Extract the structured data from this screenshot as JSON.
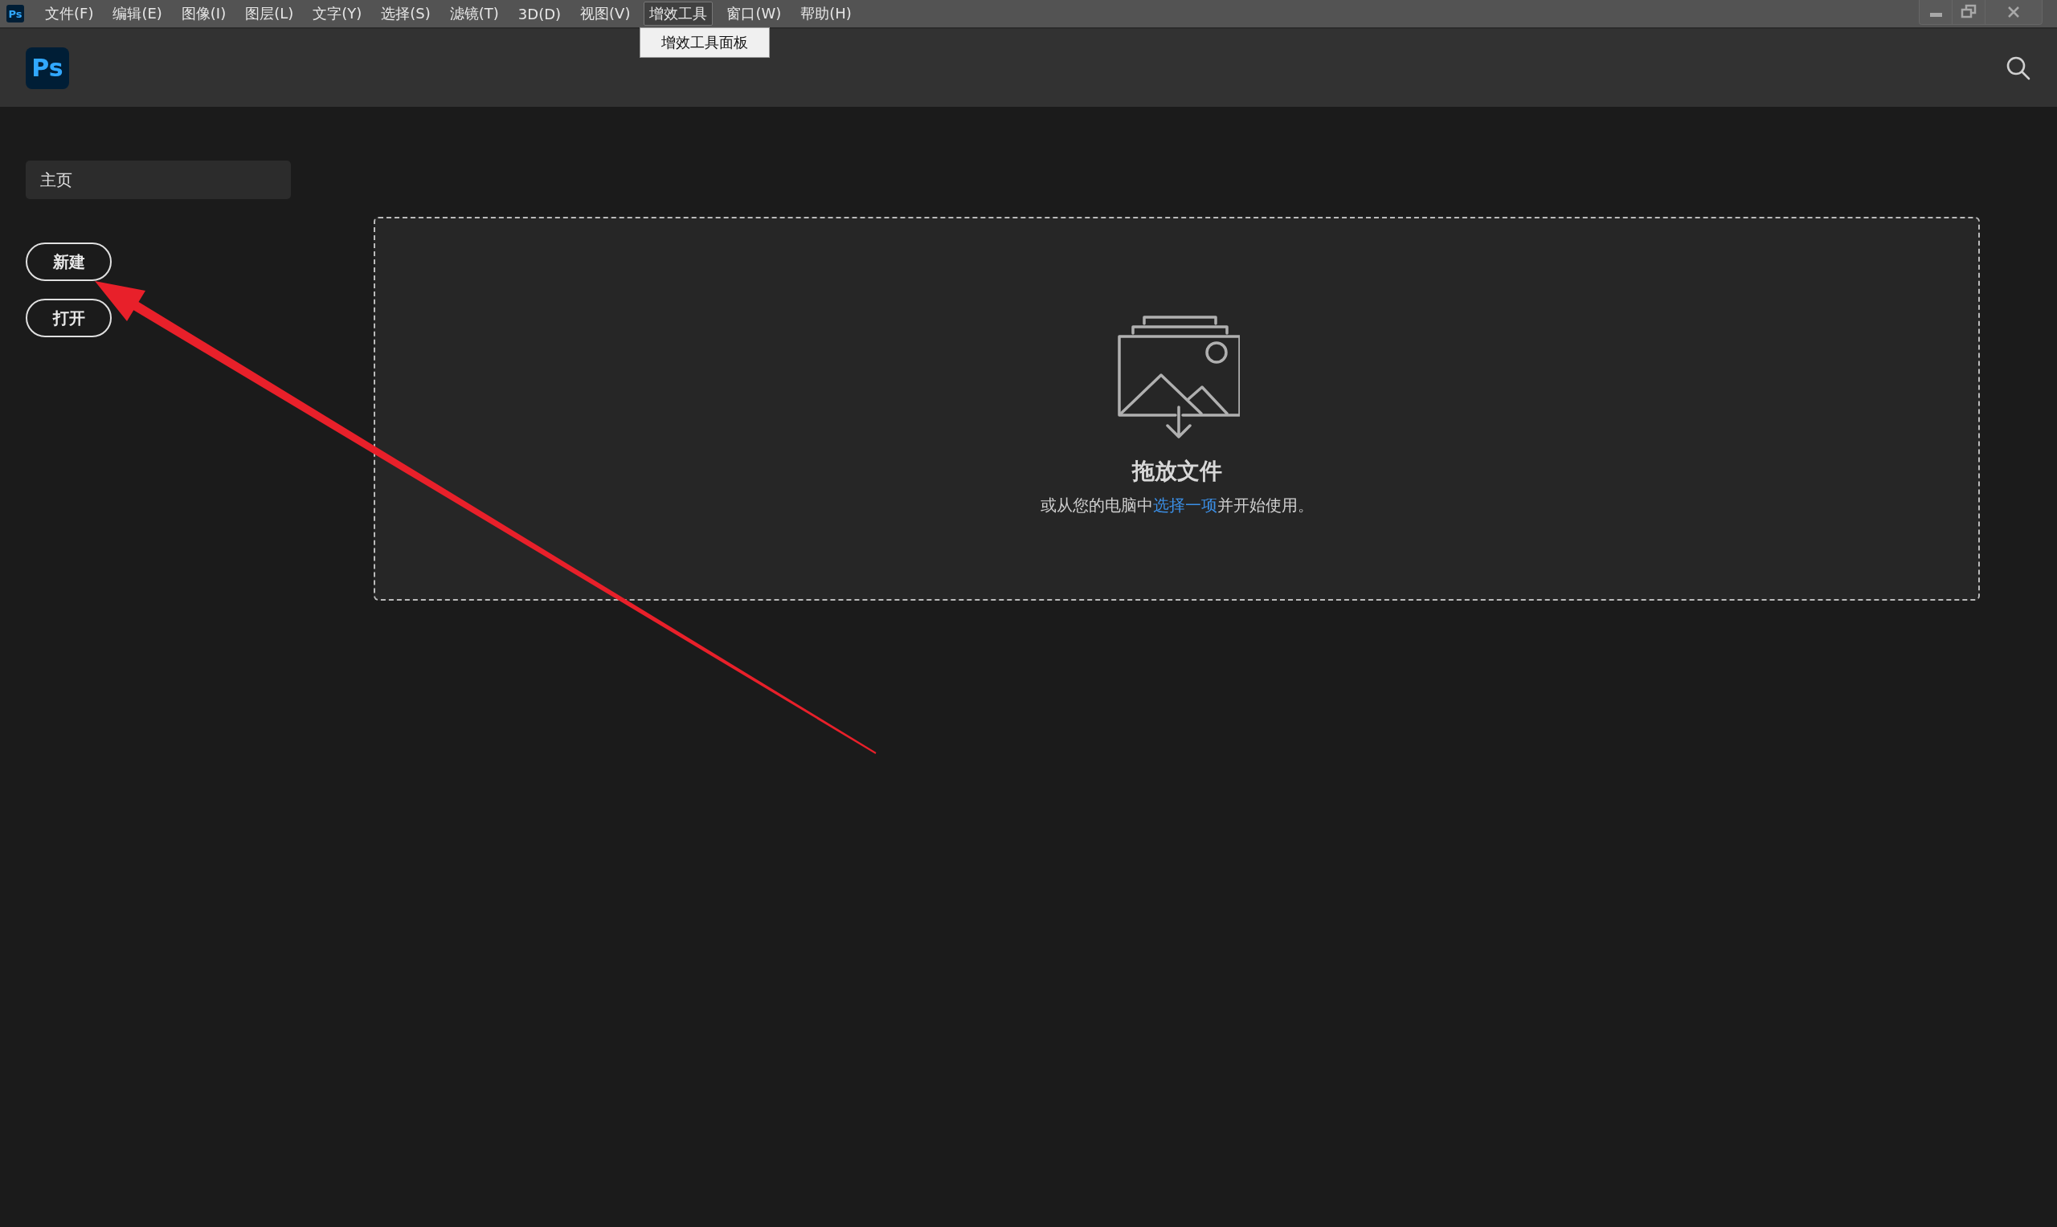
{
  "app_icon": "Ps",
  "menu_bar": [
    {
      "label": "文件(F)",
      "selected": false
    },
    {
      "label": "编辑(E)",
      "selected": false
    },
    {
      "label": "图像(I)",
      "selected": false
    },
    {
      "label": "图层(L)",
      "selected": false
    },
    {
      "label": "文字(Y)",
      "selected": false
    },
    {
      "label": "选择(S)",
      "selected": false
    },
    {
      "label": "滤镜(T)",
      "selected": false
    },
    {
      "label": "3D(D)",
      "selected": false
    },
    {
      "label": "视图(V)",
      "selected": false
    },
    {
      "label": "增效工具",
      "selected": true
    },
    {
      "label": "窗口(W)",
      "selected": false
    },
    {
      "label": "帮助(H)",
      "selected": false
    }
  ],
  "open_menu": {
    "items": [
      "增效工具面板"
    ]
  },
  "header": {
    "logo": "Ps"
  },
  "sidebar": {
    "items": [
      {
        "label": "主页",
        "selected": true
      }
    ],
    "buttons": [
      "新建",
      "打开"
    ]
  },
  "drop_zone": {
    "title": "拖放文件",
    "text_before": "或从您的电脑中",
    "link": "选择一项",
    "text_after": "并开始使用。"
  }
}
